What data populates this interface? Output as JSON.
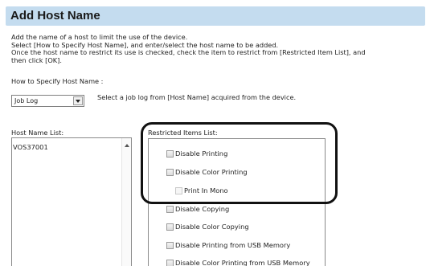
{
  "header": {
    "title": "Add Host Name"
  },
  "instructions": [
    "Add the name of a host to limit the use of the device.",
    "Select [How to Specify Host Name], and enter/select the host name to be added.",
    "Once the host name to restrict its use is checked, check the item to restrict from [Restricted Item List], and",
    "then click [OK]."
  ],
  "how_to_specify": {
    "label": "How to Specify Host Name :",
    "selected": "Job Log",
    "hint": "Select a job log from [Host Name] acquired from the device."
  },
  "host_list": {
    "label": "Host Name List:",
    "items": [
      "VOS37001"
    ]
  },
  "restricted_list": {
    "label": "Restricted Items List:",
    "items": [
      "Disable Printing",
      "Disable Color Printing",
      "Print In Mono",
      "Disable Copying",
      "Disable Color Copying",
      "Disable Printing from USB Memory",
      "Disable Color Printing from USB Memory"
    ]
  }
}
